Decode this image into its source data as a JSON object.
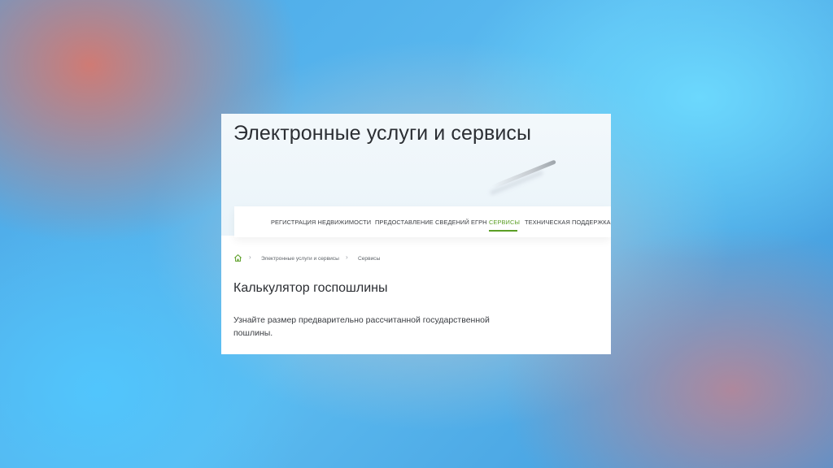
{
  "hero": {
    "title": "Электронные услуги и сервисы"
  },
  "nav": {
    "items": [
      {
        "label": "РЕГИСТРАЦИЯ НЕДВИЖИМОСТИ"
      },
      {
        "label": "ПРЕДОСТАВЛЕНИЕ СВЕДЕНИЙ ЕГРН"
      },
      {
        "label": "СЕРВИСЫ",
        "active": true
      },
      {
        "label": "ТЕХНИЧЕСКАЯ ПОДДЕРЖКА"
      }
    ]
  },
  "breadcrumb": {
    "items": [
      {
        "label": "Электронные услуги и сервисы"
      },
      {
        "label": "Сервисы"
      }
    ]
  },
  "main": {
    "title": "Калькулятор госпошлины",
    "description": "Узнайте размер предварительно рассчитанной государственной пошлины."
  },
  "colors": {
    "accent_green": "#5b9e25",
    "text_dark": "#2b2e33"
  },
  "icons": {
    "home": "home-icon",
    "separator": "chevron-right-icon"
  }
}
